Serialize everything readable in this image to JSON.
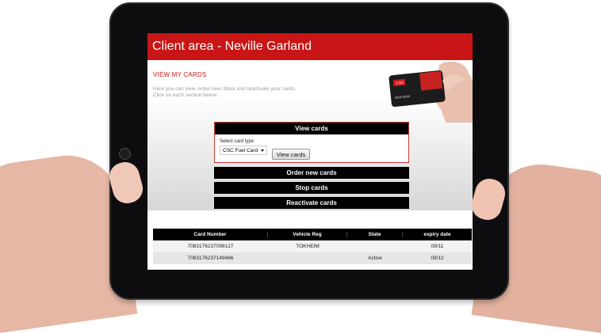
{
  "header": {
    "title": "Client area - Neville Garland"
  },
  "section": {
    "title": "VIEW MY CARDS",
    "intro_line1": "Here you can view, order new, block and reactivate your cards.",
    "intro_line2": "Click on each section below:"
  },
  "panel": {
    "view_cards_title": "View cards",
    "select_label": "Select card type",
    "select_value": "CSC Fuel Card",
    "view_button": "View cards",
    "order_new": "Order new cards",
    "stop": "Stop cards",
    "reactivate": "Reactivate cards"
  },
  "table": {
    "headers": [
      "Card Number",
      "Vehicle Reg",
      "State",
      "expiry date"
    ],
    "rows": [
      [
        "7083176237098127",
        "TOKHEIM",
        "",
        "09/11"
      ],
      [
        "7083176237149466",
        "",
        "Active",
        "09/12"
      ]
    ]
  },
  "card_image": {
    "brand": "CSC",
    "number": "0000 0000"
  },
  "colors": {
    "brand_red": "#c91515",
    "tablet": "#0d0d0f"
  }
}
